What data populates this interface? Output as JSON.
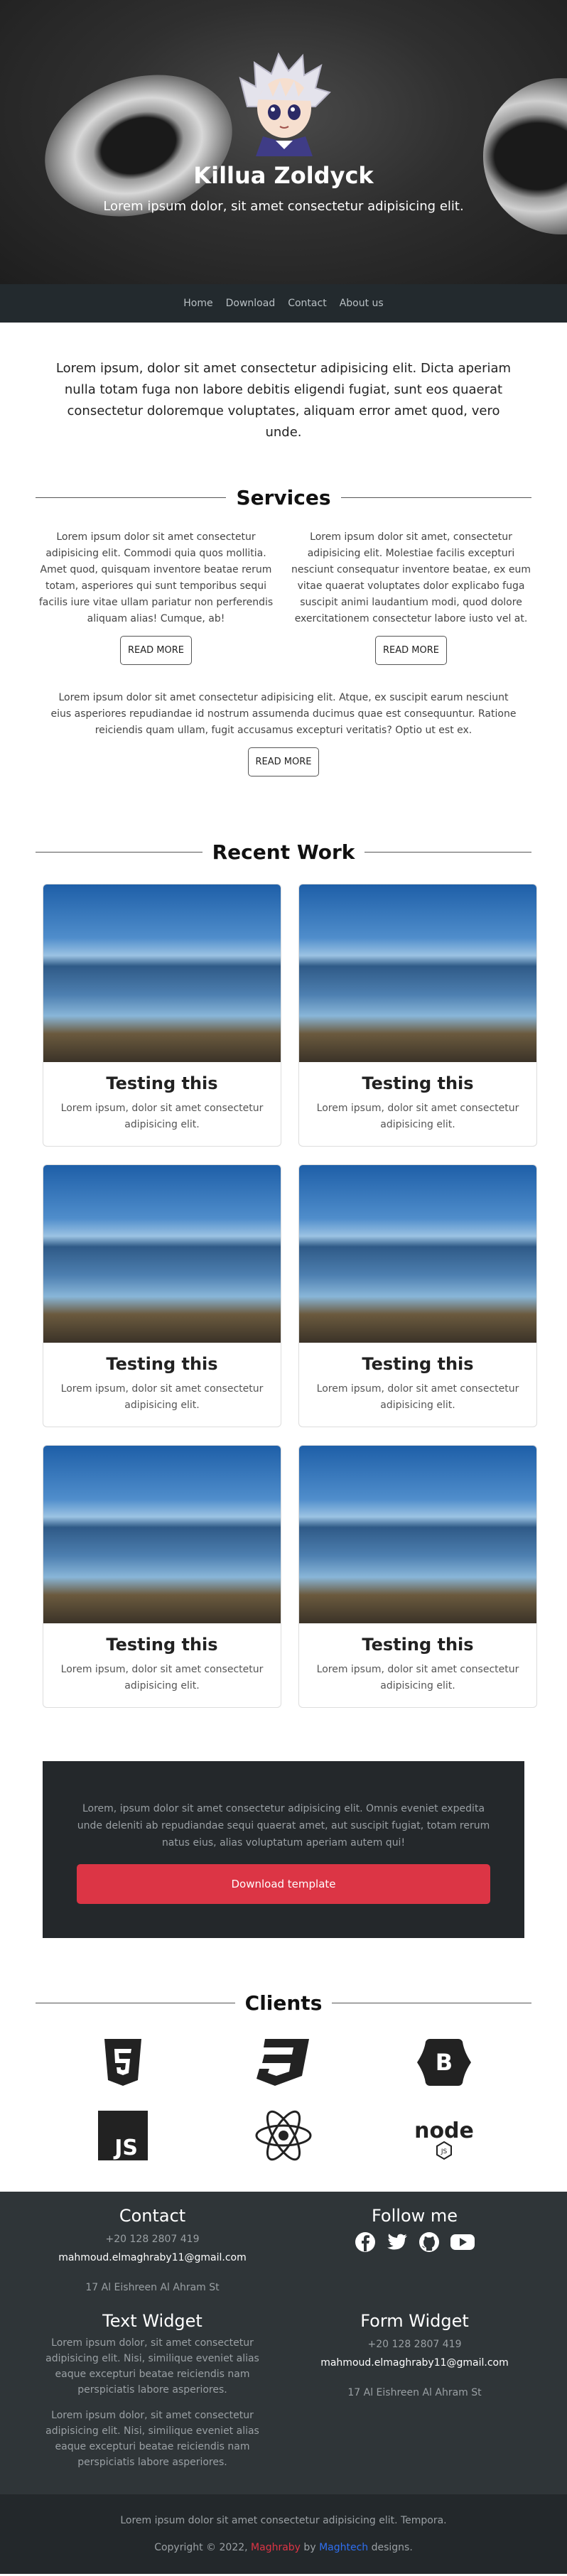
{
  "hero": {
    "title": "Killua Zoldyck",
    "subtitle": "Lorem ipsum dolor, sit amet consectetur adipisicing elit."
  },
  "nav": {
    "items": [
      "Home",
      "Download",
      "Contact",
      "About us"
    ]
  },
  "intro": "Lorem ipsum, dolor sit amet consectetur adipisicing elit. Dicta aperiam nulla totam fuga non labore debitis eligendi fugiat, sunt eos quaerat consectetur doloremque voluptates, aliquam error amet quod, vero unde.",
  "services": {
    "heading": "Services",
    "items": [
      {
        "text": "Lorem ipsum dolor sit amet consectetur adipisicing elit. Commodi quia quos mollitia. Amet quod, quisquam inventore beatae rerum totam, asperiores qui sunt temporibus sequi facilis iure vitae ullam pariatur non perferendis aliquam alias! Cumque, ab!",
        "button": "READ MORE"
      },
      {
        "text": "Lorem ipsum dolor sit amet, consectetur adipisicing elit. Molestiae facilis excepturi nesciunt consequatur inventore beatae, ex eum vitae quaerat voluptates dolor explicabo fuga suscipit animi laudantium modi, quod dolore exercitationem consectetur labore iusto vel at.",
        "button": "READ MORE"
      },
      {
        "text": "Lorem ipsum dolor sit amet consectetur adipisicing elit. Atque, ex suscipit earum nesciunt eius asperiores repudiandae id nostrum assumenda ducimus quae est consequuntur. Ratione reiciendis quam ullam, fugit accusamus excepturi veritatis? Optio ut est ex.",
        "button": "READ MORE"
      }
    ]
  },
  "work": {
    "heading": "Recent Work",
    "cards": [
      {
        "title": "Testing this",
        "text": "Lorem ipsum, dolor sit amet consectetur adipisicing elit."
      },
      {
        "title": "Testing this",
        "text": "Lorem ipsum, dolor sit amet consectetur adipisicing elit."
      },
      {
        "title": "Testing this",
        "text": "Lorem ipsum, dolor sit amet consectetur adipisicing elit."
      },
      {
        "title": "Testing this",
        "text": "Lorem ipsum, dolor sit amet consectetur adipisicing elit."
      },
      {
        "title": "Testing this",
        "text": "Lorem ipsum, dolor sit amet consectetur adipisicing elit."
      },
      {
        "title": "Testing this",
        "text": "Lorem ipsum, dolor sit amet consectetur adipisicing elit."
      }
    ]
  },
  "download": {
    "text": "Lorem, ipsum dolor sit amet consectetur adipisicing elit. Omnis eveniet expedita unde deleniti ab repudiandae sequi quaerat amet, aut suscipit fugiat, totam rerum natus eius, alias voluptatum aperiam autem qui!",
    "button": "Download template"
  },
  "clients": {
    "heading": "Clients",
    "logos": [
      "html5-logo-icon",
      "css3-logo-icon",
      "bootstrap-logo-icon",
      "javascript-logo-icon",
      "react-logo-icon",
      "nodejs-logo-icon"
    ],
    "js_text": "JS",
    "bootstrap_text": "B",
    "node_text": "node"
  },
  "footer": {
    "contact": {
      "title": "Contact",
      "phone": "+20 128 2807 419",
      "email": "mahmoud.elmaghraby11@gmail.com",
      "address": "17 Al Eishreen Al Ahram St"
    },
    "follow": {
      "title": "Follow me",
      "icons": [
        "facebook-icon",
        "twitter-icon",
        "github-icon",
        "youtube-icon"
      ]
    },
    "text_widget": {
      "title": "Text Widget",
      "paragraphs": [
        "Lorem ipsum dolor, sit amet consectetur adipisicing elit. Nisi, similique eveniet alias eaque excepturi beatae reiciendis nam perspiciatis labore asperiores.",
        "Lorem ipsum dolor, sit amet consectetur adipisicing elit. Nisi, similique eveniet alias eaque excepturi beatae reiciendis nam perspiciatis labore asperiores."
      ]
    },
    "form_widget": {
      "title": "Form Widget",
      "phone": "+20 128 2807 419",
      "email": "mahmoud.elmaghraby11@gmail.com",
      "address": "17 Al Eishreen Al Ahram St"
    }
  },
  "bottom": {
    "line1": "Lorem ipsum dolor sit amet consectetur adipisicing elit. Tempora.",
    "copyright_prefix": "Copyright © 2022, ",
    "author": "Maghraby",
    "by": " by ",
    "company": "Maghtech",
    "suffix": " designs."
  },
  "colors": {
    "accent": "#dc3545",
    "link_blue": "#2f6ff0",
    "dark": "#24282b",
    "footer": "#2f3538"
  }
}
